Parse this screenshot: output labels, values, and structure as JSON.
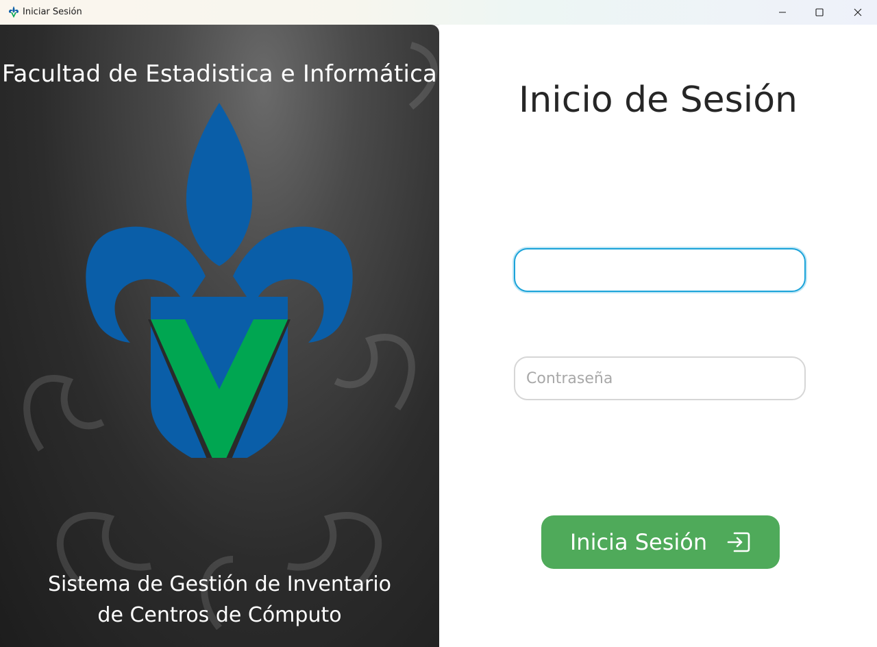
{
  "window": {
    "title": "Iniciar Sesión",
    "app_icon": "uv-logo-icon",
    "controls": [
      "minimize-icon",
      "maximize-icon",
      "close-icon"
    ]
  },
  "left_panel": {
    "faculty_title": "Facultad de Estadistica e Informática",
    "logo": "uv-logo",
    "system_name_line1": "Sistema de Gestión de Inventario",
    "system_name_line2": "de Centros de Cómputo"
  },
  "login": {
    "title": "Inicio de Sesión",
    "username": {
      "value": "",
      "placeholder": ""
    },
    "password": {
      "value": "",
      "placeholder": "Contraseña"
    },
    "submit_label": "Inicia Sesión",
    "submit_icon": "sign-in-icon"
  },
  "colors": {
    "accent_green": "#4faa5a",
    "logo_blue": "#0a5ea8",
    "logo_green": "#00a651",
    "focus_border": "#1aa3d9"
  }
}
